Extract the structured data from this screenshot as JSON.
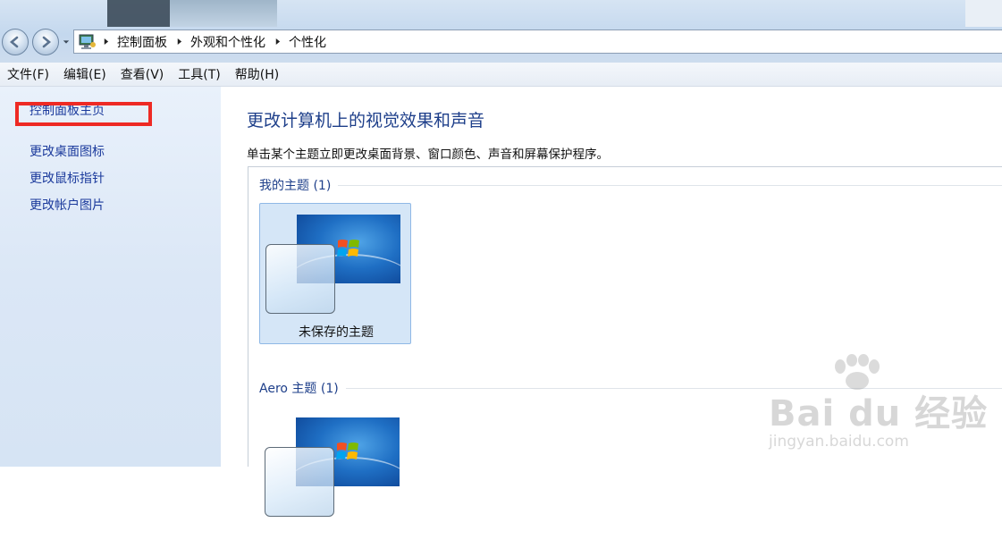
{
  "breadcrumb": [
    "控制面板",
    "外观和个性化",
    "个性化"
  ],
  "menu": [
    "文件(F)",
    "编辑(E)",
    "查看(V)",
    "工具(T)",
    "帮助(H)"
  ],
  "sidebar": {
    "items": [
      {
        "label": "控制面板主页"
      },
      {
        "label": "更改桌面图标"
      },
      {
        "label": "更改鼠标指针"
      },
      {
        "label": "更改帐户图片"
      }
    ]
  },
  "main": {
    "title": "更改计算机上的视觉效果和声音",
    "subtitle": "单击某个主题立即更改桌面背景、窗口颜色、声音和屏幕保护程序。",
    "groups": [
      {
        "label": "我的主题 (1)",
        "themes": [
          {
            "name": "未保存的主题"
          }
        ]
      },
      {
        "label": "Aero 主题 (1)",
        "themes": [
          {
            "name": ""
          }
        ]
      }
    ]
  },
  "watermark": {
    "brand": "Bai du 经验",
    "url": "jingyan.baidu.com"
  },
  "colors": {
    "highlight": "#ee2a24",
    "link": "#1b3a9c",
    "heading": "#1e3f8a"
  }
}
